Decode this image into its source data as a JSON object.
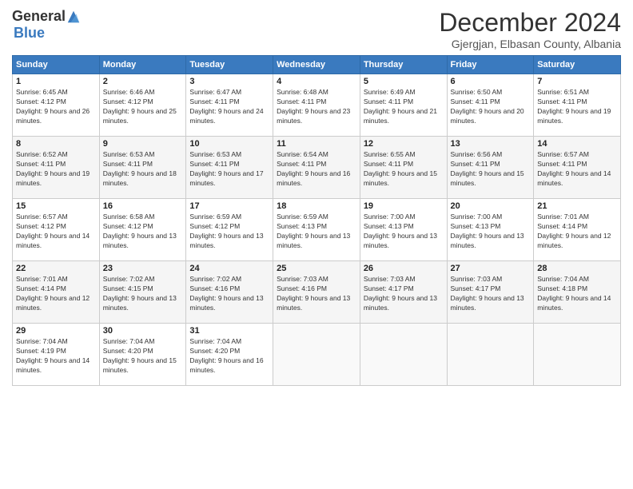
{
  "logo": {
    "general": "General",
    "blue": "Blue"
  },
  "title": "December 2024",
  "location": "Gjergjan, Elbasan County, Albania",
  "days_header": [
    "Sunday",
    "Monday",
    "Tuesday",
    "Wednesday",
    "Thursday",
    "Friday",
    "Saturday"
  ],
  "weeks": [
    [
      {
        "day": "1",
        "sunrise": "6:45 AM",
        "sunset": "4:12 PM",
        "daylight": "9 hours and 26 minutes."
      },
      {
        "day": "2",
        "sunrise": "6:46 AM",
        "sunset": "4:12 PM",
        "daylight": "9 hours and 25 minutes."
      },
      {
        "day": "3",
        "sunrise": "6:47 AM",
        "sunset": "4:11 PM",
        "daylight": "9 hours and 24 minutes."
      },
      {
        "day": "4",
        "sunrise": "6:48 AM",
        "sunset": "4:11 PM",
        "daylight": "9 hours and 23 minutes."
      },
      {
        "day": "5",
        "sunrise": "6:49 AM",
        "sunset": "4:11 PM",
        "daylight": "9 hours and 21 minutes."
      },
      {
        "day": "6",
        "sunrise": "6:50 AM",
        "sunset": "4:11 PM",
        "daylight": "9 hours and 20 minutes."
      },
      {
        "day": "7",
        "sunrise": "6:51 AM",
        "sunset": "4:11 PM",
        "daylight": "9 hours and 19 minutes."
      }
    ],
    [
      {
        "day": "8",
        "sunrise": "6:52 AM",
        "sunset": "4:11 PM",
        "daylight": "9 hours and 19 minutes."
      },
      {
        "day": "9",
        "sunrise": "6:53 AM",
        "sunset": "4:11 PM",
        "daylight": "9 hours and 18 minutes."
      },
      {
        "day": "10",
        "sunrise": "6:53 AM",
        "sunset": "4:11 PM",
        "daylight": "9 hours and 17 minutes."
      },
      {
        "day": "11",
        "sunrise": "6:54 AM",
        "sunset": "4:11 PM",
        "daylight": "9 hours and 16 minutes."
      },
      {
        "day": "12",
        "sunrise": "6:55 AM",
        "sunset": "4:11 PM",
        "daylight": "9 hours and 15 minutes."
      },
      {
        "day": "13",
        "sunrise": "6:56 AM",
        "sunset": "4:11 PM",
        "daylight": "9 hours and 15 minutes."
      },
      {
        "day": "14",
        "sunrise": "6:57 AM",
        "sunset": "4:11 PM",
        "daylight": "9 hours and 14 minutes."
      }
    ],
    [
      {
        "day": "15",
        "sunrise": "6:57 AM",
        "sunset": "4:12 PM",
        "daylight": "9 hours and 14 minutes."
      },
      {
        "day": "16",
        "sunrise": "6:58 AM",
        "sunset": "4:12 PM",
        "daylight": "9 hours and 13 minutes."
      },
      {
        "day": "17",
        "sunrise": "6:59 AM",
        "sunset": "4:12 PM",
        "daylight": "9 hours and 13 minutes."
      },
      {
        "day": "18",
        "sunrise": "6:59 AM",
        "sunset": "4:13 PM",
        "daylight": "9 hours and 13 minutes."
      },
      {
        "day": "19",
        "sunrise": "7:00 AM",
        "sunset": "4:13 PM",
        "daylight": "9 hours and 13 minutes."
      },
      {
        "day": "20",
        "sunrise": "7:00 AM",
        "sunset": "4:13 PM",
        "daylight": "9 hours and 13 minutes."
      },
      {
        "day": "21",
        "sunrise": "7:01 AM",
        "sunset": "4:14 PM",
        "daylight": "9 hours and 12 minutes."
      }
    ],
    [
      {
        "day": "22",
        "sunrise": "7:01 AM",
        "sunset": "4:14 PM",
        "daylight": "9 hours and 12 minutes."
      },
      {
        "day": "23",
        "sunrise": "7:02 AM",
        "sunset": "4:15 PM",
        "daylight": "9 hours and 13 minutes."
      },
      {
        "day": "24",
        "sunrise": "7:02 AM",
        "sunset": "4:16 PM",
        "daylight": "9 hours and 13 minutes."
      },
      {
        "day": "25",
        "sunrise": "7:03 AM",
        "sunset": "4:16 PM",
        "daylight": "9 hours and 13 minutes."
      },
      {
        "day": "26",
        "sunrise": "7:03 AM",
        "sunset": "4:17 PM",
        "daylight": "9 hours and 13 minutes."
      },
      {
        "day": "27",
        "sunrise": "7:03 AM",
        "sunset": "4:17 PM",
        "daylight": "9 hours and 13 minutes."
      },
      {
        "day": "28",
        "sunrise": "7:04 AM",
        "sunset": "4:18 PM",
        "daylight": "9 hours and 14 minutes."
      }
    ],
    [
      {
        "day": "29",
        "sunrise": "7:04 AM",
        "sunset": "4:19 PM",
        "daylight": "9 hours and 14 minutes."
      },
      {
        "day": "30",
        "sunrise": "7:04 AM",
        "sunset": "4:20 PM",
        "daylight": "9 hours and 15 minutes."
      },
      {
        "day": "31",
        "sunrise": "7:04 AM",
        "sunset": "4:20 PM",
        "daylight": "9 hours and 16 minutes."
      },
      null,
      null,
      null,
      null
    ]
  ]
}
